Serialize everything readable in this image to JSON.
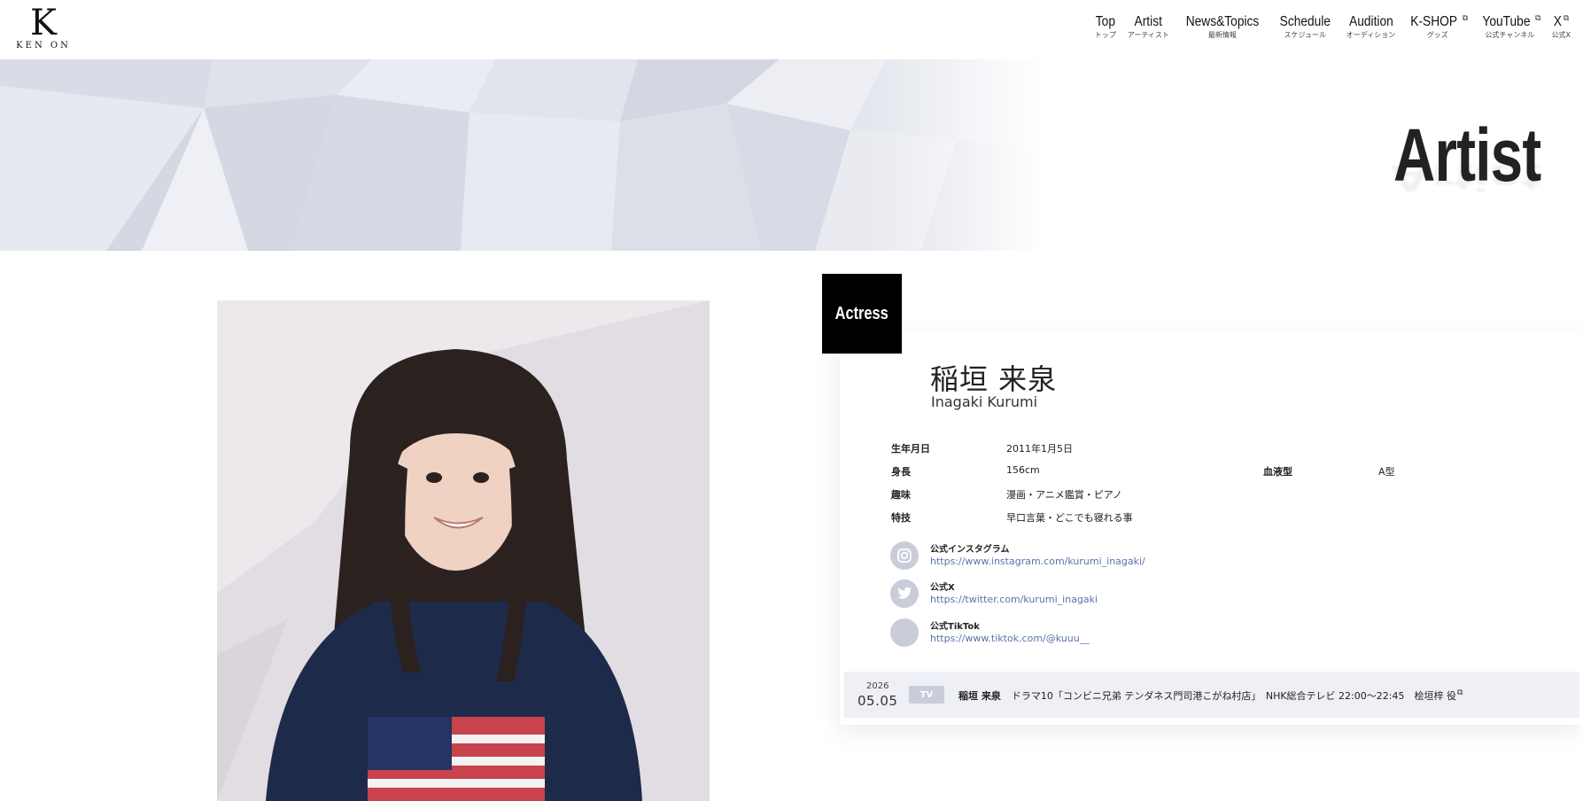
{
  "logo": {
    "letter": "K",
    "text": "KEN ON"
  },
  "nav": [
    {
      "main": "Top",
      "sub": "トップ",
      "external": false
    },
    {
      "main": "Artist",
      "sub": "アーティスト",
      "external": false
    },
    {
      "main": "News&Topics",
      "sub": "最新情報",
      "external": false
    },
    {
      "main": "Schedule",
      "sub": "スケジュール",
      "external": false
    },
    {
      "main": "Audition",
      "sub": "オーディション",
      "external": false
    },
    {
      "main": "K-SHOP",
      "sub": "グッズ",
      "external": true
    },
    {
      "main": "YouTube",
      "sub": "公式チャンネル",
      "external": true
    },
    {
      "main": "X",
      "sub": "公式X",
      "external": true
    }
  ],
  "hero": {
    "title": "Artist"
  },
  "artist": {
    "category": "Actress",
    "name_jp": "稲垣 来泉",
    "name_en": "Inagaki Kurumi"
  },
  "profile": {
    "birthday_label": "生年月日",
    "birthday": "2011年1月5日",
    "height_label": "身長",
    "height": "156cm",
    "blood_label": "血液型",
    "blood": "A型",
    "hobby_label": "趣味",
    "hobby": "漫画・アニメ鑑賞・ピアノ",
    "skill_label": "特技",
    "skill": "早口言葉・どこでも寝れる事"
  },
  "sns": [
    {
      "title": "公式インスタグラム",
      "url": "https://www.instagram.com/kurumi_inagaki/",
      "icon": "instagram-icon"
    },
    {
      "title": "公式X",
      "url": "https://twitter.com/kurumi_inagaki",
      "icon": "twitter-icon"
    },
    {
      "title": "公式TikTok",
      "url": "https://www.tiktok.com/@kuuu__",
      "icon": "tiktok-icon"
    }
  ],
  "schedule": {
    "year": "2026",
    "date": "05.05",
    "tag": "TV",
    "who": "稲垣 来泉",
    "text": "ドラマ10「コンビニ兄弟 テンダネス門司港こがね村店」　NHK総合テレビ 22:00～22:45　桧垣梓 役"
  },
  "colors": {
    "accent": "#000000",
    "sns_icon": "#c9ccd9",
    "link": "#5a73a8",
    "schedule_bg": "#eef0f5"
  }
}
